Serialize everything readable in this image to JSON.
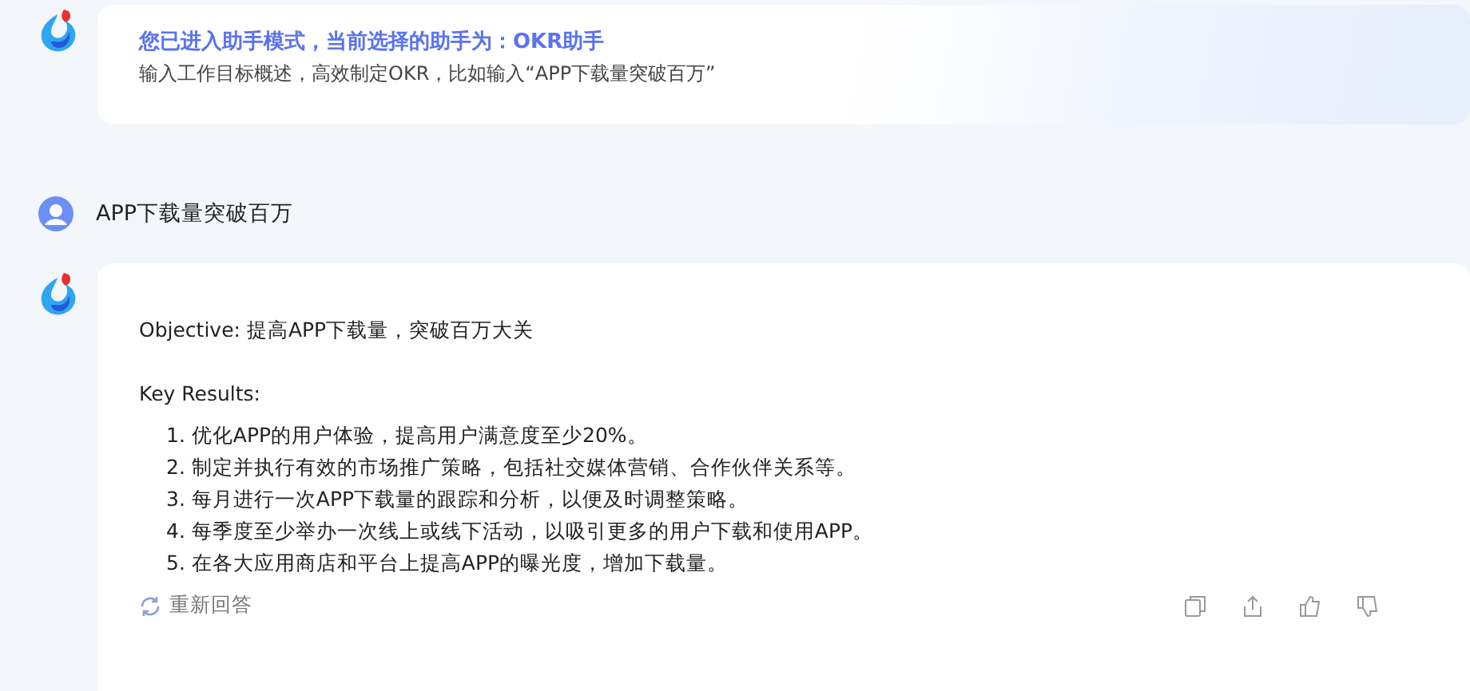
{
  "intro": {
    "title": "您已进入助手模式，当前选择的助手为：OKR助手",
    "hint": "输入工作目标概述，高效制定OKR，比如输入“APP下载量突破百万”"
  },
  "user_message": {
    "text": "APP下载量突破百万"
  },
  "answer": {
    "objective": "Objective: 提高APP下载量，突破百万大关",
    "key_results_label": "Key Results:",
    "items": [
      "1. 优化APP的用户体验，提高用户满意度至少20%。",
      "2. 制定并执行有效的市场推广策略，包括社交媒体营销、合作伙伴关系等。",
      "3. 每月进行一次APP下载量的跟踪和分析，以便及时调整策略。",
      "4. 每季度至少举办一次线上或线下活动，以吸引更多的用户下载和使用APP。",
      "5. 在各大应用商店和平台上提高APP的曝光度，增加下载量。"
    ],
    "regenerate": "重新回答"
  }
}
